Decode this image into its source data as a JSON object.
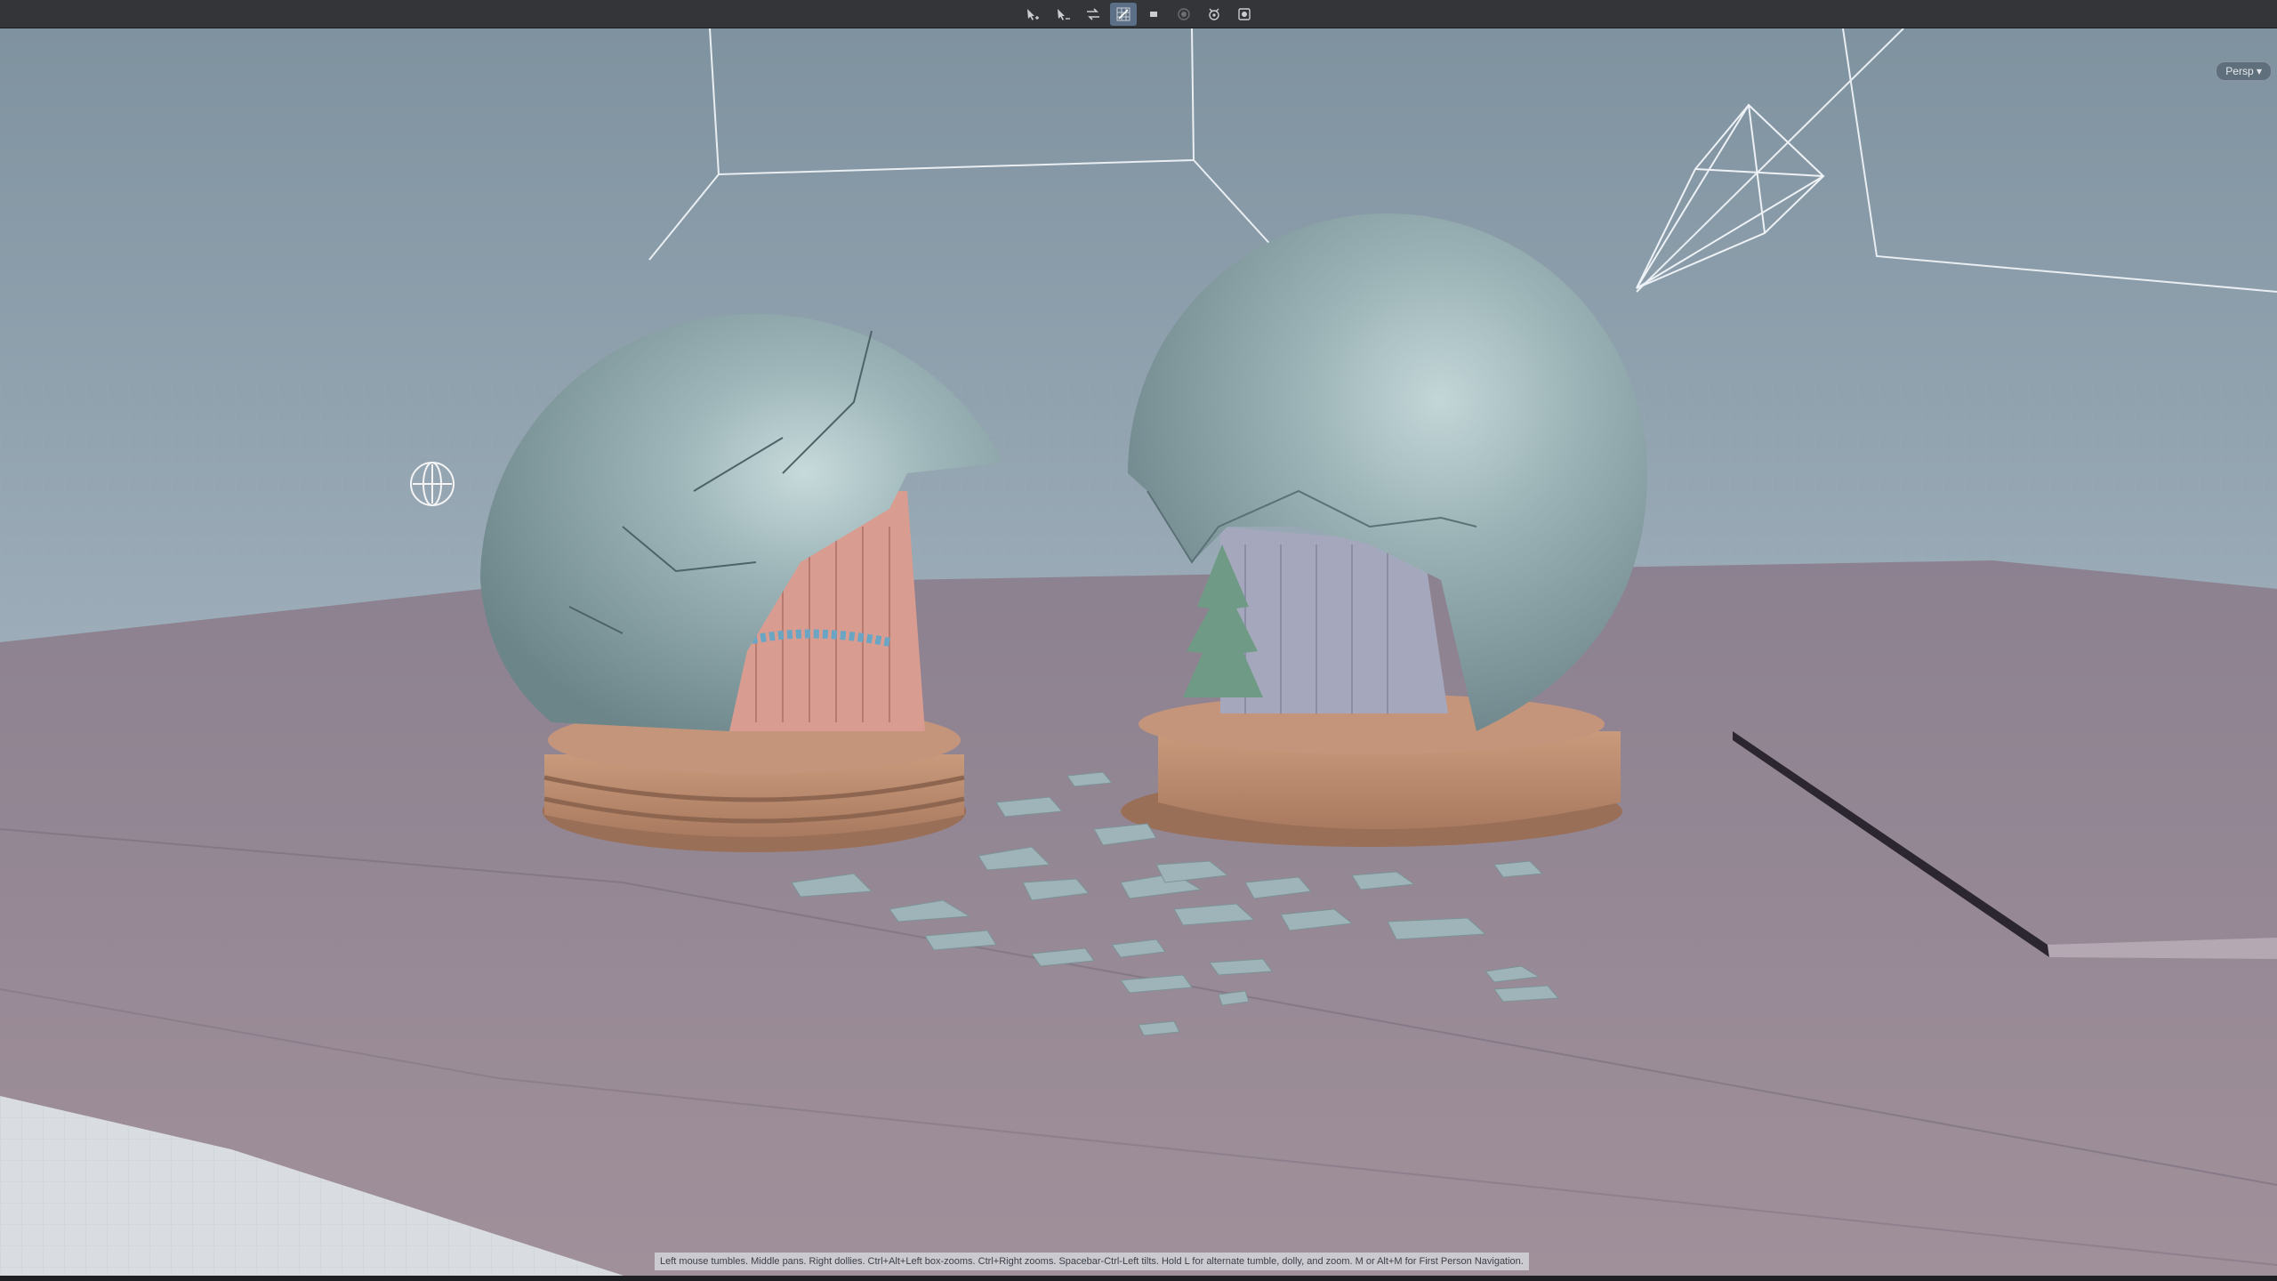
{
  "toolbar": {
    "tools": [
      {
        "name": "select-tool-icon",
        "active": false
      },
      {
        "name": "move-tool-icon",
        "active": false
      },
      {
        "name": "transform-tool-icon",
        "active": false
      },
      {
        "name": "grid-snap-icon",
        "active": true
      },
      {
        "name": "display-mode-icon",
        "active": false
      },
      {
        "name": "record-icon",
        "active": false
      },
      {
        "name": "camera-rig-icon",
        "active": false
      },
      {
        "name": "render-icon",
        "active": false
      }
    ]
  },
  "viewport": {
    "camera_menu": "Persp ▾",
    "status_hint": "Left mouse tumbles. Middle pans. Right dollies. Ctrl+Alt+Left box-zooms. Ctrl+Right zooms. Spacebar-Ctrl-Left tilts. Hold L for alternate tumble, dolly, and zoom. M or Alt+M for First Person Navigation."
  },
  "scene": {
    "sky_color": "#8fa1ae",
    "floor_color": "#8f8790",
    "table_color": "#9b8a93",
    "globe_color": "#8fa6aa",
    "base_color": "#b7876c",
    "left_house_color": "#d89a8e",
    "right_house_color": "#a4a6bc"
  }
}
